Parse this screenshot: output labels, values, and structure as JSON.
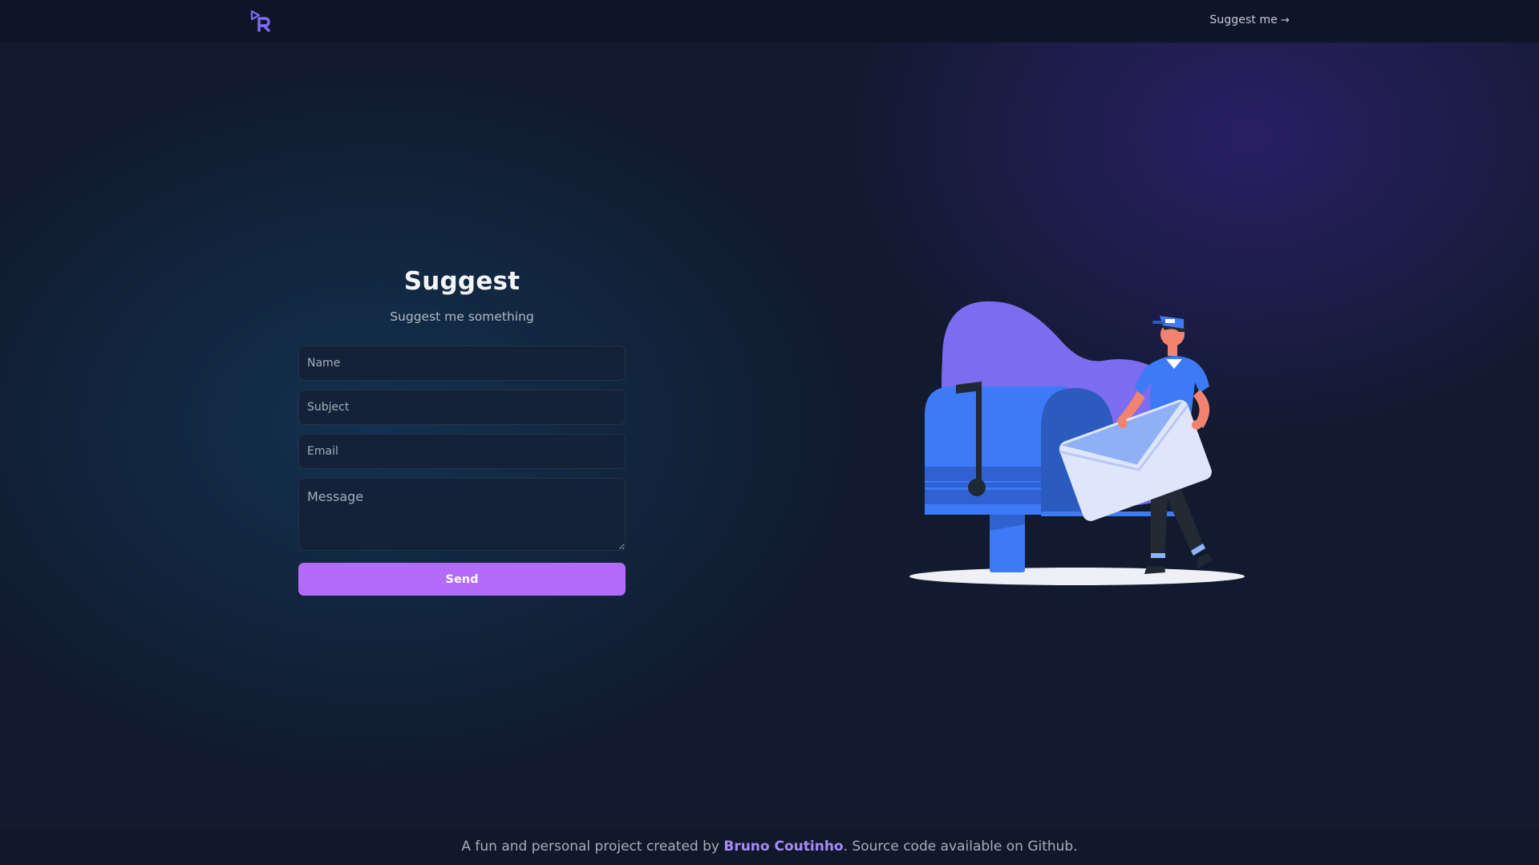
{
  "header": {
    "logo_alt": "R",
    "nav_link_label": "Suggest me",
    "nav_link_arrow": "→"
  },
  "form": {
    "title": "Suggest",
    "subtitle": "Suggest me something",
    "name_placeholder": "Name",
    "subject_placeholder": "Subject",
    "email_placeholder": "Email",
    "message_placeholder": "Message",
    "send_label": "Send"
  },
  "footer": {
    "prefix": "A fun and personal project created by ",
    "author": "Bruno Coutinho",
    "suffix": ". Source code available on Github."
  },
  "colors": {
    "background": "#111a2e",
    "accent": "#b36bf9",
    "link": "#a78bfa",
    "logo": "#7c6cf0"
  },
  "icons": {
    "logo": "play-r-logo-icon",
    "nav_arrow": "arrow-right-icon",
    "illustration": "mailbox-postman-illustration"
  }
}
